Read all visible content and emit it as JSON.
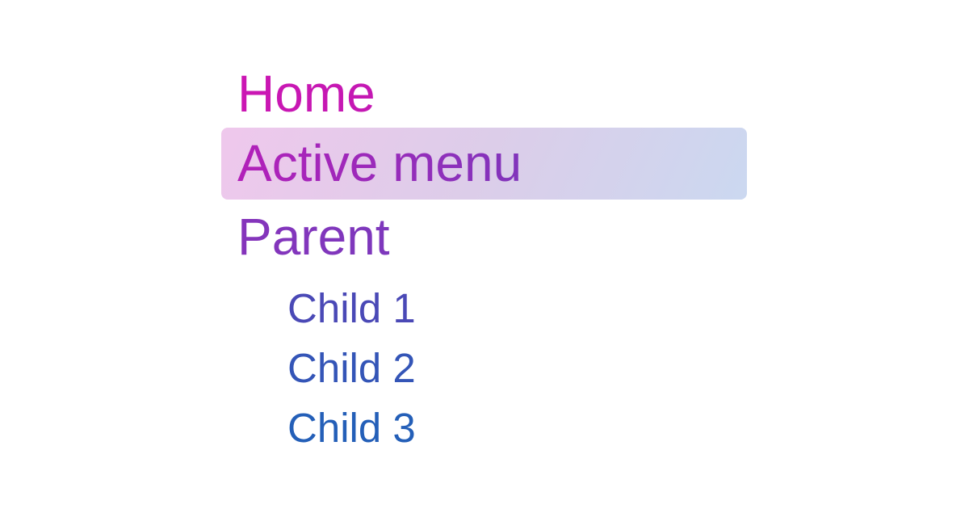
{
  "menu": {
    "items": [
      {
        "label": "Home",
        "color": "#c419ad",
        "active": false,
        "level": 1
      },
      {
        "label": "Active menu",
        "color": "#9a2cb8",
        "active": true,
        "level": 1
      },
      {
        "label": "Parent",
        "color": "#7a3bbd",
        "active": false,
        "level": 1
      }
    ],
    "children": [
      {
        "label": "Child 1",
        "color": "#4b4ab8",
        "level": 2
      },
      {
        "label": "Child 2",
        "color": "#3656b7",
        "level": 2
      },
      {
        "label": "Child 3",
        "color": "#2560b8",
        "level": 2
      }
    ]
  },
  "colors": {
    "active_background_start": "#efc8ec",
    "active_background_end": "#cbd8f0"
  }
}
